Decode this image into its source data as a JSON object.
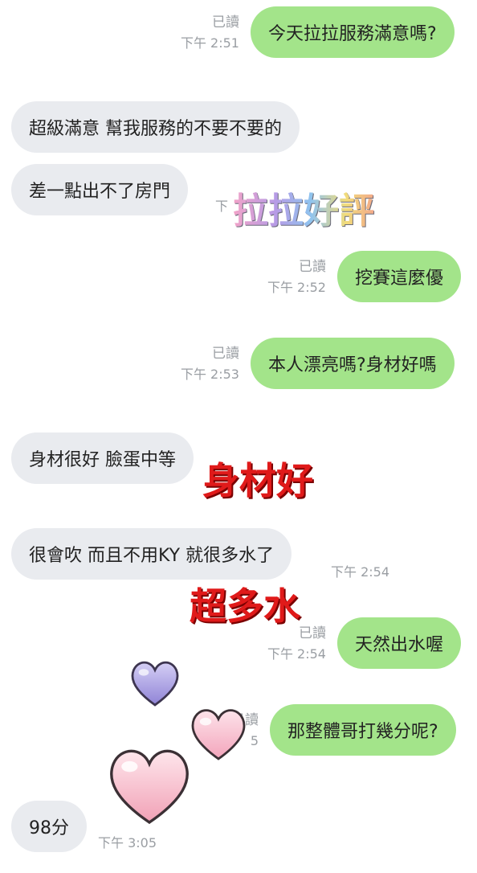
{
  "messages": {
    "m1": {
      "text": "今天拉拉服務滿意嗎?",
      "read": "已讀",
      "time": "下午 2:51"
    },
    "m2": {
      "text": "超級滿意 幫我服務的不要不要的"
    },
    "m3": {
      "text": "差一點出不了房門",
      "time": "下"
    },
    "m4": {
      "text": "挖賽這麼優",
      "read": "已讀",
      "time": "下午 2:52"
    },
    "m5": {
      "text": "本人漂亮嗎?身材好嗎",
      "read": "已讀",
      "time": "下午 2:53"
    },
    "m6": {
      "text": "身材很好 臉蛋中等"
    },
    "m7": {
      "text": "很會吹 而且不用KY 就很多水了",
      "time": "下午 2:54"
    },
    "m8": {
      "text": "天然出水喔",
      "read": "已讀",
      "time": "下午 2:54"
    },
    "m9": {
      "text": "那整體哥打幾分呢?",
      "read": "已讀",
      "time": "5"
    },
    "m10": {
      "text": "98分",
      "time": "下午 3:05"
    }
  },
  "stickers": {
    "s1": "拉拉好評",
    "s2": "身材好",
    "s3": "超多水"
  },
  "colors": {
    "sent_bubble": "#a3e48a",
    "recv_bubble": "#e9ebef",
    "meta_text": "#9a9ea3",
    "sticker_red": "#e01a1a",
    "heart_purple": "#a79de0",
    "heart_pink": "#f6b9c9"
  },
  "icons": {
    "heart_1": "purple-heart-icon",
    "heart_2": "pink-heart-icon",
    "heart_3": "large-pink-heart-icon"
  }
}
